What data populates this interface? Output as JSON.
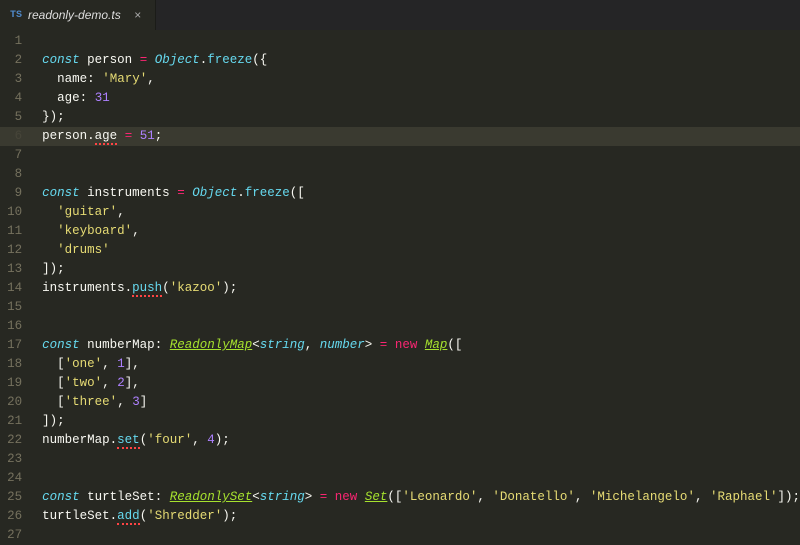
{
  "tab": {
    "icon_label": "TS",
    "filename": "readonly-demo.ts",
    "close_glyph": "×"
  },
  "active_line": 6,
  "gutter": {
    "total_lines": 27
  },
  "lines": {
    "1": [],
    "2": [
      {
        "cls": "tk-kw",
        "text": "const"
      },
      {
        "cls": "tk-var",
        "text": " person "
      },
      {
        "cls": "tk-op",
        "text": "="
      },
      {
        "cls": "tk-var",
        "text": " "
      },
      {
        "cls": "tk-type",
        "text": "Object"
      },
      {
        "cls": "tk-punct",
        "text": "."
      },
      {
        "cls": "tk-fn",
        "text": "freeze"
      },
      {
        "cls": "tk-punct",
        "text": "({"
      }
    ],
    "3": [
      {
        "cls": "tk-var",
        "text": "  name"
      },
      {
        "cls": "tk-punct",
        "text": ": "
      },
      {
        "cls": "tk-str",
        "text": "'Mary'"
      },
      {
        "cls": "tk-punct",
        "text": ","
      }
    ],
    "4": [
      {
        "cls": "tk-var",
        "text": "  age"
      },
      {
        "cls": "tk-punct",
        "text": ": "
      },
      {
        "cls": "tk-num",
        "text": "31"
      }
    ],
    "5": [
      {
        "cls": "tk-punct",
        "text": "});"
      }
    ],
    "6": [
      {
        "cls": "tk-var",
        "text": "person."
      },
      {
        "cls": "tk-var err-prop",
        "text": "age"
      },
      {
        "cls": "tk-var",
        "text": " "
      },
      {
        "cls": "tk-op",
        "text": "="
      },
      {
        "cls": "tk-var",
        "text": " "
      },
      {
        "cls": "tk-num",
        "text": "51"
      },
      {
        "cls": "tk-punct",
        "text": ";"
      }
    ],
    "7": [],
    "8": [],
    "9": [
      {
        "cls": "tk-kw",
        "text": "const"
      },
      {
        "cls": "tk-var",
        "text": " instruments "
      },
      {
        "cls": "tk-op",
        "text": "="
      },
      {
        "cls": "tk-var",
        "text": " "
      },
      {
        "cls": "tk-type",
        "text": "Object"
      },
      {
        "cls": "tk-punct",
        "text": "."
      },
      {
        "cls": "tk-fn",
        "text": "freeze"
      },
      {
        "cls": "tk-punct",
        "text": "(["
      }
    ],
    "10": [
      {
        "cls": "tk-var",
        "text": "  "
      },
      {
        "cls": "tk-str",
        "text": "'guitar'"
      },
      {
        "cls": "tk-punct",
        "text": ","
      }
    ],
    "11": [
      {
        "cls": "tk-var",
        "text": "  "
      },
      {
        "cls": "tk-str",
        "text": "'keyboard'"
      },
      {
        "cls": "tk-punct",
        "text": ","
      }
    ],
    "12": [
      {
        "cls": "tk-var",
        "text": "  "
      },
      {
        "cls": "tk-str",
        "text": "'drums'"
      }
    ],
    "13": [
      {
        "cls": "tk-punct",
        "text": "]);"
      }
    ],
    "14": [
      {
        "cls": "tk-var",
        "text": "instruments."
      },
      {
        "cls": "tk-fn err-fn",
        "text": "push"
      },
      {
        "cls": "tk-punct",
        "text": "("
      },
      {
        "cls": "tk-str",
        "text": "'kazoo'"
      },
      {
        "cls": "tk-punct",
        "text": ");"
      }
    ],
    "15": [],
    "16": [],
    "17": [
      {
        "cls": "tk-kw",
        "text": "const"
      },
      {
        "cls": "tk-var",
        "text": " numberMap"
      },
      {
        "cls": "tk-punct",
        "text": ": "
      },
      {
        "cls": "tk-typeref",
        "text": "ReadonlyMap"
      },
      {
        "cls": "tk-punct",
        "text": "<"
      },
      {
        "cls": "tk-obj",
        "text": "string"
      },
      {
        "cls": "tk-punct",
        "text": ", "
      },
      {
        "cls": "tk-obj",
        "text": "number"
      },
      {
        "cls": "tk-punct",
        "text": "> "
      },
      {
        "cls": "tk-op",
        "text": "="
      },
      {
        "cls": "tk-var",
        "text": " "
      },
      {
        "cls": "tk-op",
        "text": "new"
      },
      {
        "cls": "tk-var",
        "text": " "
      },
      {
        "cls": "tk-typeref",
        "text": "Map"
      },
      {
        "cls": "tk-punct",
        "text": "(["
      }
    ],
    "18": [
      {
        "cls": "tk-punct",
        "text": "  ["
      },
      {
        "cls": "tk-str",
        "text": "'one'"
      },
      {
        "cls": "tk-punct",
        "text": ", "
      },
      {
        "cls": "tk-num",
        "text": "1"
      },
      {
        "cls": "tk-punct",
        "text": "],"
      }
    ],
    "19": [
      {
        "cls": "tk-punct",
        "text": "  ["
      },
      {
        "cls": "tk-str",
        "text": "'two'"
      },
      {
        "cls": "tk-punct",
        "text": ", "
      },
      {
        "cls": "tk-num",
        "text": "2"
      },
      {
        "cls": "tk-punct",
        "text": "],"
      }
    ],
    "20": [
      {
        "cls": "tk-punct",
        "text": "  ["
      },
      {
        "cls": "tk-str",
        "text": "'three'"
      },
      {
        "cls": "tk-punct",
        "text": ", "
      },
      {
        "cls": "tk-num",
        "text": "3"
      },
      {
        "cls": "tk-punct",
        "text": "]"
      }
    ],
    "21": [
      {
        "cls": "tk-punct",
        "text": "]);"
      }
    ],
    "22": [
      {
        "cls": "tk-var",
        "text": "numberMap."
      },
      {
        "cls": "tk-fn err-fn",
        "text": "set"
      },
      {
        "cls": "tk-punct",
        "text": "("
      },
      {
        "cls": "tk-str",
        "text": "'four'"
      },
      {
        "cls": "tk-punct",
        "text": ", "
      },
      {
        "cls": "tk-num",
        "text": "4"
      },
      {
        "cls": "tk-punct",
        "text": ");"
      }
    ],
    "23": [],
    "24": [],
    "25": [
      {
        "cls": "tk-kw",
        "text": "const"
      },
      {
        "cls": "tk-var",
        "text": " turtleSet"
      },
      {
        "cls": "tk-punct",
        "text": ": "
      },
      {
        "cls": "tk-typeref",
        "text": "ReadonlySet"
      },
      {
        "cls": "tk-punct",
        "text": "<"
      },
      {
        "cls": "tk-obj",
        "text": "string"
      },
      {
        "cls": "tk-punct",
        "text": "> "
      },
      {
        "cls": "tk-op",
        "text": "="
      },
      {
        "cls": "tk-var",
        "text": " "
      },
      {
        "cls": "tk-op",
        "text": "new"
      },
      {
        "cls": "tk-var",
        "text": " "
      },
      {
        "cls": "tk-typeref",
        "text": "Set"
      },
      {
        "cls": "tk-punct",
        "text": "(["
      },
      {
        "cls": "tk-str",
        "text": "'Leonardo'"
      },
      {
        "cls": "tk-punct",
        "text": ", "
      },
      {
        "cls": "tk-str",
        "text": "'Donatello'"
      },
      {
        "cls": "tk-punct",
        "text": ", "
      },
      {
        "cls": "tk-str",
        "text": "'Michelangelo'"
      },
      {
        "cls": "tk-punct",
        "text": ", "
      },
      {
        "cls": "tk-str",
        "text": "'Raphael'"
      },
      {
        "cls": "tk-punct",
        "text": "]);"
      }
    ],
    "26": [
      {
        "cls": "tk-var",
        "text": "turtleSet."
      },
      {
        "cls": "tk-fn err-fn",
        "text": "add"
      },
      {
        "cls": "tk-punct",
        "text": "("
      },
      {
        "cls": "tk-str",
        "text": "'Shredder'"
      },
      {
        "cls": "tk-punct",
        "text": ");"
      }
    ],
    "27": []
  }
}
